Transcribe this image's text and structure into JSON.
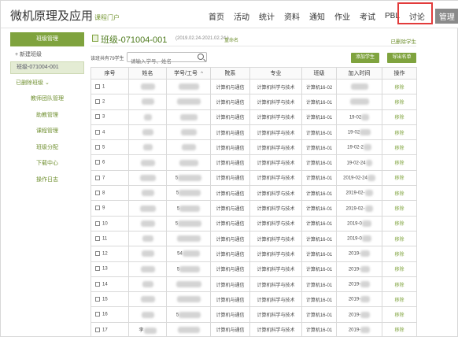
{
  "header": {
    "brand": "微机原理及应用",
    "brand_sub": "课程门户",
    "nav": [
      "首页",
      "活动",
      "统计",
      "资料",
      "通知",
      "作业",
      "考试",
      "PBL",
      "讨论",
      "管理"
    ],
    "active_nav": "管理",
    "highlight_color": "#e23b3b"
  },
  "sidebar": {
    "head": "班级管理",
    "new_class": "+ 新建班级",
    "current_class": "班级-071004-001",
    "deleted_classes": "已删除班级 ⌄",
    "links": [
      "教师团队管理",
      "助教管理",
      "课程管理",
      "班级分配",
      "下载中心",
      "操作日志"
    ]
  },
  "main": {
    "title": "班级-071004-001",
    "date_range": "(2019.02.24-2021.02.24 )",
    "rename": "重命名",
    "deleted_students": "已删除学生",
    "count_label": "该班共有79学生",
    "search_placeholder": "请输入学号、姓名",
    "add_student": "添加学生",
    "export": "导出名单",
    "columns": [
      "序号",
      "姓名",
      "学号/工号",
      "院系",
      "专业",
      "班级",
      "加入时间",
      "操作"
    ],
    "sort_indicator": "^",
    "rows": [
      {
        "no": "1",
        "name": "",
        "sid": "",
        "dept": "计算机与通信",
        "major": "计算机科学与技术",
        "cls": "计算机16-02",
        "joined": "",
        "op": "移除"
      },
      {
        "no": "2",
        "name": "",
        "sid": "",
        "dept": "计算机与通信",
        "major": "计算机科学与技术",
        "cls": "计算机16-01",
        "joined": "",
        "op": "移除"
      },
      {
        "no": "3",
        "name": "",
        "sid": "",
        "dept": "计算机与通信",
        "major": "计算机科学与技术",
        "cls": "计算机16-01",
        "joined": "19-02",
        "op": "移除"
      },
      {
        "no": "4",
        "name": "",
        "sid": "",
        "dept": "计算机与通信",
        "major": "计算机科学与技术",
        "cls": "计算机16-01",
        "joined": "19-02",
        "op": "移除"
      },
      {
        "no": "5",
        "name": "",
        "sid": "",
        "dept": "计算机与通信",
        "major": "计算机科学与技术",
        "cls": "计算机16-01",
        "joined": "19-02-2",
        "op": "移除"
      },
      {
        "no": "6",
        "name": "",
        "sid": "",
        "dept": "计算机与通信",
        "major": "计算机科学与技术",
        "cls": "计算机16-01",
        "joined": "19-02-24",
        "op": "移除"
      },
      {
        "no": "7",
        "name": "",
        "sid": "5",
        "dept": "计算机与通信",
        "major": "计算机科学与技术",
        "cls": "计算机16-01",
        "joined": "2019-02-24",
        "op": "移除"
      },
      {
        "no": "8",
        "name": "",
        "sid": "5",
        "dept": "计算机与通信",
        "major": "计算机科学与技术",
        "cls": "计算机16-01",
        "joined": "2019-02-",
        "op": "移除"
      },
      {
        "no": "9",
        "name": "",
        "sid": "5",
        "dept": "计算机与通信",
        "major": "计算机科学与技术",
        "cls": "计算机16-01",
        "joined": "2019-02-",
        "op": "移除"
      },
      {
        "no": "10",
        "name": "",
        "sid": "5",
        "dept": "计算机与通信",
        "major": "计算机科学与技术",
        "cls": "计算机16-01",
        "joined": "2019-0",
        "op": "移除"
      },
      {
        "no": "11",
        "name": "",
        "sid": "",
        "dept": "计算机与通信",
        "major": "计算机科学与技术",
        "cls": "计算机16-01",
        "joined": "2019-0",
        "op": "移除"
      },
      {
        "no": "12",
        "name": "",
        "sid": "54",
        "dept": "计算机与通信",
        "major": "计算机科学与技术",
        "cls": "计算机16-01",
        "joined": "2019-",
        "op": "移除"
      },
      {
        "no": "13",
        "name": "",
        "sid": "5",
        "dept": "计算机与通信",
        "major": "计算机科学与技术",
        "cls": "计算机16-01",
        "joined": "2019-",
        "op": "移除"
      },
      {
        "no": "14",
        "name": "",
        "sid": "",
        "dept": "计算机与通信",
        "major": "计算机科学与技术",
        "cls": "计算机16-01",
        "joined": "2019-",
        "op": "移除"
      },
      {
        "no": "15",
        "name": "",
        "sid": "",
        "dept": "计算机与通信",
        "major": "计算机科学与技术",
        "cls": "计算机16-01",
        "joined": "2019-",
        "op": "移除"
      },
      {
        "no": "16",
        "name": "",
        "sid": "5",
        "dept": "计算机与通信",
        "major": "计算机科学与技术",
        "cls": "计算机16-01",
        "joined": "2019-",
        "op": "移除"
      },
      {
        "no": "17",
        "name": "李",
        "sid": "",
        "dept": "计算机与通信",
        "major": "计算机科学与技术",
        "cls": "计算机16-01",
        "joined": "2019-",
        "op": "移除"
      }
    ]
  },
  "colors": {
    "accent": "#7fa33e",
    "accent_dark": "#4d7a1c",
    "highlight": "#e23b3b"
  }
}
